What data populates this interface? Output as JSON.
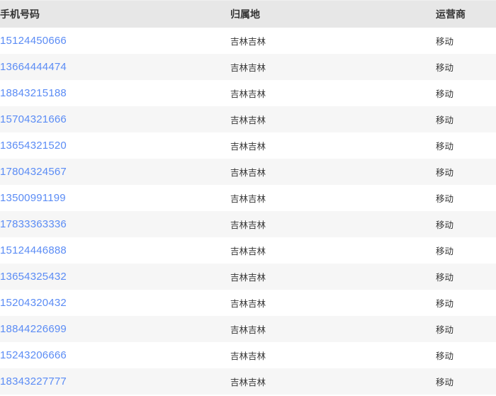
{
  "table": {
    "columns": [
      {
        "key": "phone",
        "label": "手机号码"
      },
      {
        "key": "region",
        "label": "归属地"
      },
      {
        "key": "carrier",
        "label": "运营商"
      }
    ],
    "link_color": "#5b8cf5",
    "header_bg": "#e7e7e7",
    "row_bg": "#ffffff",
    "row_alt_bg": "#f6f6f6",
    "rows": [
      {
        "phone": "15124450666",
        "region": "吉林吉林",
        "carrier": "移动"
      },
      {
        "phone": "13664444474",
        "region": "吉林吉林",
        "carrier": "移动"
      },
      {
        "phone": "18843215188",
        "region": "吉林吉林",
        "carrier": "移动"
      },
      {
        "phone": "15704321666",
        "region": "吉林吉林",
        "carrier": "移动"
      },
      {
        "phone": "13654321520",
        "region": "吉林吉林",
        "carrier": "移动"
      },
      {
        "phone": "17804324567",
        "region": "吉林吉林",
        "carrier": "移动"
      },
      {
        "phone": "13500991199",
        "region": "吉林吉林",
        "carrier": "移动"
      },
      {
        "phone": "17833363336",
        "region": "吉林吉林",
        "carrier": "移动"
      },
      {
        "phone": "15124446888",
        "region": "吉林吉林",
        "carrier": "移动"
      },
      {
        "phone": "13654325432",
        "region": "吉林吉林",
        "carrier": "移动"
      },
      {
        "phone": "15204320432",
        "region": "吉林吉林",
        "carrier": "移动"
      },
      {
        "phone": "18844226699",
        "region": "吉林吉林",
        "carrier": "移动"
      },
      {
        "phone": "15243206666",
        "region": "吉林吉林",
        "carrier": "移动"
      },
      {
        "phone": "18343227777",
        "region": "吉林吉林",
        "carrier": "移动"
      }
    ]
  }
}
